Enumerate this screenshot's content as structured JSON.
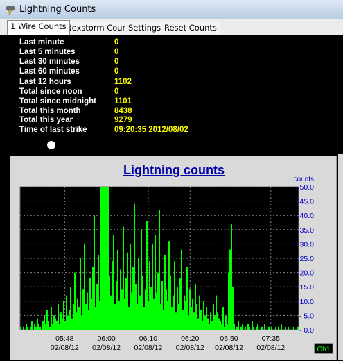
{
  "window": {
    "title": "Lightning Counts",
    "icon": "lightning-cloud-icon"
  },
  "tabs": [
    {
      "label": "1 Wire Counts",
      "active": true
    },
    {
      "label": "Nexstorm Counts",
      "active": false
    },
    {
      "label": "Settings",
      "active": false
    },
    {
      "label": "Reset Counts",
      "active": false
    }
  ],
  "stats": [
    {
      "label": "Last minute",
      "value": "0"
    },
    {
      "label": "Last 5 minutes",
      "value": "0"
    },
    {
      "label": "Last 30 minutes",
      "value": "0"
    },
    {
      "label": "Last 60 minutes",
      "value": "0"
    },
    {
      "label": "Last 12 hours",
      "value": "1102"
    },
    {
      "label": "Total since noon",
      "value": "0"
    },
    {
      "label": "Total since midnight",
      "value": "1101"
    },
    {
      "label": "Total this month",
      "value": "8438"
    },
    {
      "label": "Total this year",
      "value": "9279"
    },
    {
      "label": "Time of last strike",
      "value": "09:20:35 2012/08/02"
    }
  ],
  "colors": {
    "stat_label": "#ffffff",
    "stat_value": "#ffff00",
    "chart_bar": "#00ff00",
    "chart_bg": "#000000",
    "axis_text": "#0000cc",
    "title": "#0000aa"
  },
  "chart_data": {
    "type": "bar",
    "title": "Lightning counts",
    "ylabel": "counts",
    "ylim": [
      0,
      50
    ],
    "y_ticks": [
      "0.0",
      "5.0",
      "10.0",
      "15.0",
      "20.0",
      "25.0",
      "30.0",
      "35.0",
      "40.0",
      "45.0",
      "50.0"
    ],
    "x_ticks": [
      {
        "time": "05:48",
        "date": "02/08/12"
      },
      {
        "time": "06:00",
        "date": "02/08/12"
      },
      {
        "time": "06:10",
        "date": "02/08/12"
      },
      {
        "time": "06:20",
        "date": "02/08/12"
      },
      {
        "time": "06:50",
        "date": "02/08/12"
      },
      {
        "time": "07:35",
        "date": "02/08/12"
      }
    ],
    "channel_badge": "Ch1",
    "grid": true,
    "values": [
      1,
      0,
      1,
      0,
      2,
      1,
      0,
      1,
      3,
      0,
      2,
      1,
      4,
      2,
      1,
      0,
      3,
      5,
      2,
      7,
      3,
      1,
      8,
      2,
      5,
      4,
      3,
      9,
      2,
      6,
      4,
      10,
      3,
      12,
      5,
      7,
      15,
      4,
      9,
      20,
      6,
      11,
      8,
      25,
      5,
      14,
      30,
      9,
      13,
      7,
      18,
      11,
      22,
      40,
      8,
      16,
      26,
      10,
      50,
      50,
      50,
      50,
      50,
      50,
      19,
      12,
      24,
      33,
      9,
      17,
      28,
      10,
      21,
      14,
      36,
      11,
      18,
      27,
      8,
      30,
      13,
      22,
      44,
      16,
      9,
      25,
      12,
      35,
      19,
      8,
      14,
      38,
      10,
      24,
      15,
      30,
      11,
      33,
      13,
      20,
      42,
      9,
      17,
      7,
      26,
      14,
      10,
      31,
      19,
      8,
      12,
      24,
      6,
      15,
      9,
      18,
      28,
      7,
      12,
      10,
      22,
      5,
      14,
      8,
      11,
      6,
      16,
      9,
      4,
      12,
      7,
      3,
      10,
      5,
      8,
      4,
      2,
      6,
      3,
      9,
      5,
      12,
      6,
      4,
      3,
      2,
      8,
      1,
      5,
      2,
      20,
      28,
      37,
      15,
      2,
      0,
      1,
      3,
      0,
      1,
      2,
      0,
      1,
      0,
      2,
      1,
      0,
      3,
      1,
      0,
      1,
      2,
      0,
      0,
      1,
      0,
      2,
      0,
      0,
      1,
      0,
      1,
      0,
      0,
      1,
      0,
      1,
      0,
      2,
      0,
      0,
      1,
      0,
      1,
      0,
      0,
      0,
      1,
      0,
      0,
      1
    ]
  }
}
